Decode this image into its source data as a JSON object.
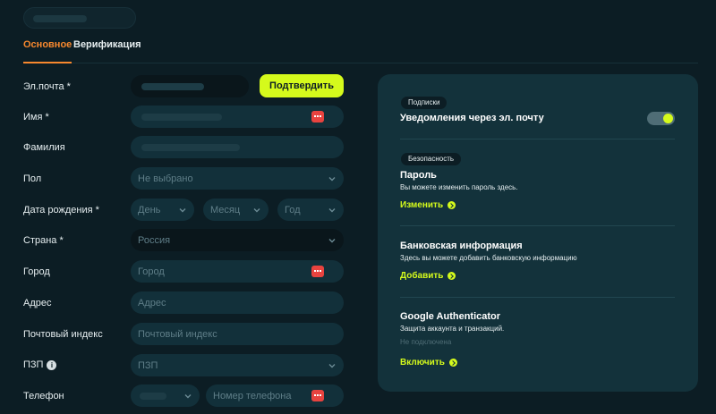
{
  "tabs": [
    {
      "label": "Основное",
      "active": true
    },
    {
      "label": "Верификация",
      "active": false
    }
  ],
  "form": {
    "email": {
      "label": "Эл.почта *",
      "confirm_label": "Подтвердить"
    },
    "first_name": {
      "label": "Имя *"
    },
    "last_name": {
      "label": "Фамилия"
    },
    "gender": {
      "label": "Пол",
      "value": "Не выбрано"
    },
    "birthdate": {
      "label": "Дата рождения *",
      "day": "День",
      "month": "Месяц",
      "year": "Год"
    },
    "country": {
      "label": "Страна *",
      "value": "Россия"
    },
    "city": {
      "label": "Город",
      "placeholder": "Город"
    },
    "address": {
      "label": "Адрес",
      "placeholder": "Адрес"
    },
    "postal": {
      "label": "Почтовый индекс",
      "placeholder": "Почтовый индекс"
    },
    "pzp": {
      "label": "ПЗП",
      "value": "ПЗП"
    },
    "phone": {
      "label": "Телефон",
      "placeholder": "Номер телефона"
    }
  },
  "panel": {
    "subscriptions": {
      "badge": "Подписки",
      "title": "Уведомления через эл. почту",
      "toggle_on": true
    },
    "security": {
      "badge": "Безопасность",
      "password": {
        "title": "Пароль",
        "desc": "Вы можете изменить пароль здесь.",
        "link": "Изменить"
      },
      "bank": {
        "title": "Банковская информация",
        "desc": "Здесь вы можете добавить банковскую информацию",
        "link": "Добавить"
      },
      "google": {
        "title": "Google Authenticator",
        "desc": "Защита аккаунта и транзакций.",
        "status": "Не подключена",
        "link": "Включить"
      }
    }
  },
  "colors": {
    "accent": "#d5fa1c",
    "tab_active": "#f7882e",
    "background": "#0c1d24",
    "panel": "#13323b",
    "warning_icon": "#e8433f"
  }
}
